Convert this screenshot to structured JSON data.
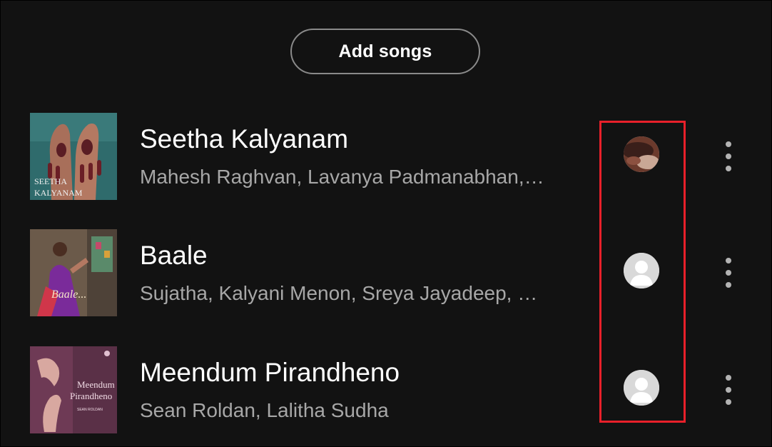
{
  "add_songs_label": "Add songs",
  "tracks": [
    {
      "title": "Seetha Kalyanam",
      "artists": "Mahesh Raghvan, Lavanya Padmanabhan,…",
      "cover_text_line1": "SEETHA",
      "cover_text_line2": "KALYANAM"
    },
    {
      "title": "Baale",
      "artists": "Sujatha, Kalyani Menon, Sreya Jayadeep, …",
      "cover_text_line1": "Baale..."
    },
    {
      "title": "Meendum Pirandheno",
      "artists": "Sean Roldan, Lalitha Sudha",
      "cover_text_line1": "Meendum",
      "cover_text_line2": "Pirandheno",
      "cover_text_line3": "SEAN ROLDAN"
    }
  ],
  "colors": {
    "background": "#121212",
    "highlight": "#e8202a",
    "title": "#ffffff",
    "subtitle": "#a7a7a7"
  },
  "icons": {
    "more": "more-vertical-icon",
    "avatar_placeholder": "user-placeholder-icon"
  }
}
